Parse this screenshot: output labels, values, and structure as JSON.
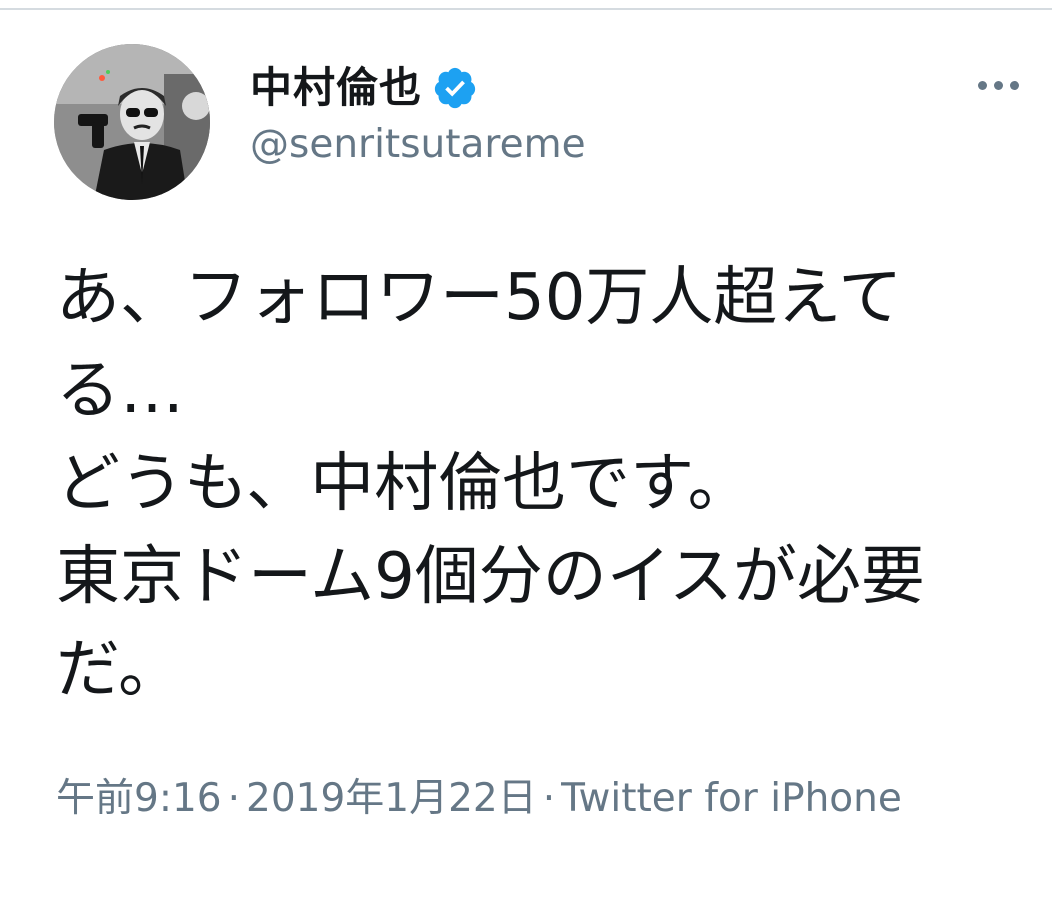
{
  "header": {
    "display_name": "中村倫也",
    "handle": "@senritsutareme",
    "verified": true,
    "verified_color": "#1da1f2"
  },
  "tweet": {
    "lines": [
      "あ、フォロワー50万人超えて",
      "る…",
      "どうも、中村倫也です。",
      "東京ドーム9個分のイスが必要",
      "だ。"
    ]
  },
  "meta": {
    "time": "午前9:16",
    "separator": "·",
    "date": "2019年1月22日",
    "source": "Twitter for iPhone"
  },
  "icons": {
    "more": "more-horizontal-icon",
    "verified": "verified-badge-icon"
  },
  "colors": {
    "text_primary": "#14171a",
    "text_secondary": "#657786"
  }
}
